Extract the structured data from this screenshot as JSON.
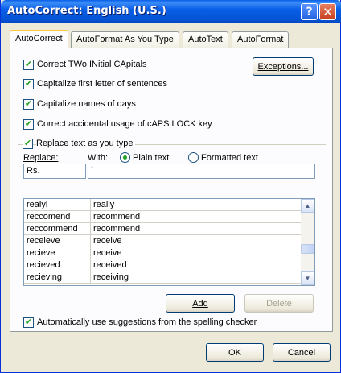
{
  "window": {
    "title": "AutoCorrect: English (U.S.)",
    "help_glyph": "?",
    "close_glyph": "✕"
  },
  "tabs": [
    {
      "label": "AutoCorrect",
      "active": true
    },
    {
      "label": "AutoFormat As You Type",
      "active": false
    },
    {
      "label": "AutoText",
      "active": false
    },
    {
      "label": "AutoFormat",
      "active": false
    }
  ],
  "options": {
    "correct_two_initials": {
      "label": "Correct TWo INitial CApitals",
      "checked": true
    },
    "capitalize_sentences": {
      "label": "Capitalize first letter of sentences",
      "checked": true
    },
    "capitalize_days": {
      "label": "Capitalize names of days",
      "checked": true
    },
    "caps_lock": {
      "label": "Correct accidental usage of cAPS LOCK key",
      "checked": true
    },
    "replace_as_you_type": {
      "label": "Replace text as you type",
      "checked": true
    },
    "spelling_suggestions": {
      "label": "Automatically use suggestions from the spelling checker",
      "checked": true
    }
  },
  "exceptions_button": "Exceptions...",
  "replace": {
    "replace_label": "Replace:",
    "with_label": "With:",
    "plain_text": "Plain text",
    "formatted_text": "Formatted text",
    "plain_selected": true,
    "replace_value": "Rs.",
    "with_value": "`"
  },
  "entries": [
    {
      "replace": "realyl",
      "with": "really"
    },
    {
      "replace": "reccomend",
      "with": "recommend"
    },
    {
      "replace": "reccommend",
      "with": "recommend"
    },
    {
      "replace": "receieve",
      "with": "receive"
    },
    {
      "replace": "recieve",
      "with": "receive"
    },
    {
      "replace": "recieved",
      "with": "received"
    },
    {
      "replace": "recieving",
      "with": "receiving"
    }
  ],
  "scroll_up_glyph": "▲",
  "scroll_down_glyph": "▼",
  "check_glyph": "✔",
  "buttons": {
    "add": "Add",
    "delete": "Delete",
    "ok": "OK",
    "cancel": "Cancel"
  }
}
